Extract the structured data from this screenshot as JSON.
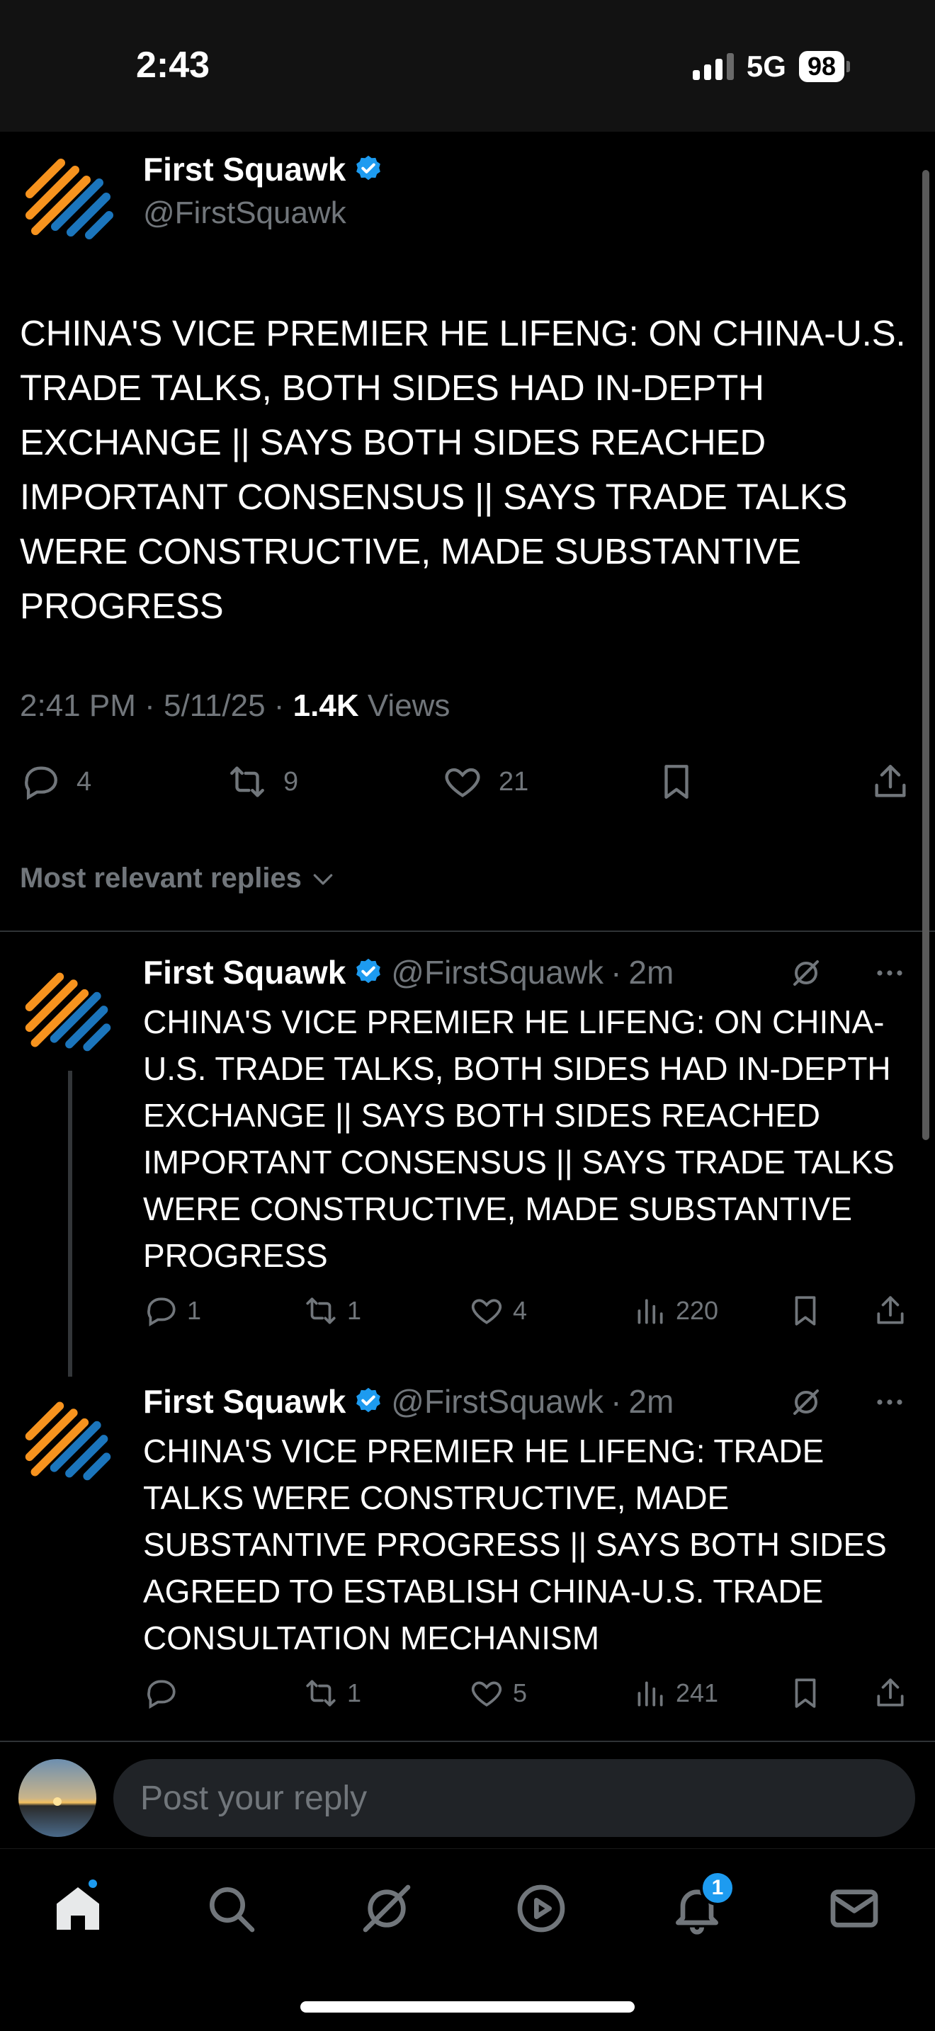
{
  "status_bar": {
    "time": "2:43",
    "network": "5G",
    "battery": "98"
  },
  "main_tweet": {
    "author_name": "First Squawk",
    "author_handle": "@FirstSquawk",
    "text": "CHINA'S VICE PREMIER HE LIFENG: ON CHINA-U.S. TRADE TALKS, BOTH SIDES HAD IN-DEPTH EXCHANGE || SAYS BOTH SIDES REACHED IMPORTANT CONSENSUS || SAYS TRADE TALKS WERE CONSTRUCTIVE, MADE SUBSTANTIVE PROGRESS",
    "time": "2:41 PM",
    "date": "5/11/25",
    "views_count": "1.4K",
    "views_label": "Views",
    "replies": "4",
    "reposts": "9",
    "likes": "21"
  },
  "replies_sort": {
    "label": "Most relevant replies"
  },
  "replies": [
    {
      "author_name": "First Squawk",
      "author_handle": "@FirstSquawk",
      "time": "2m",
      "text": "CHINA'S VICE PREMIER HE LIFENG: ON CHINA-U.S. TRADE TALKS, BOTH SIDES HAD IN-DEPTH EXCHANGE || SAYS BOTH SIDES REACHED IMPORTANT CONSENSUS || SAYS TRADE TALKS WERE CONSTRUCTIVE, MADE SUBSTANTIVE PROGRESS",
      "replies": "1",
      "reposts": "1",
      "likes": "4",
      "views": "220"
    },
    {
      "author_name": "First Squawk",
      "author_handle": "@FirstSquawk",
      "time": "2m",
      "text": "CHINA'S VICE PREMIER HE LIFENG: TRADE TALKS WERE CONSTRUCTIVE, MADE SUBSTANTIVE PROGRESS || SAYS BOTH SIDES AGREED TO ESTABLISH CHINA-U.S. TRADE CONSULTATION MECHANISM",
      "replies": "",
      "reposts": "1",
      "likes": "5",
      "views": "241"
    }
  ],
  "composer": {
    "placeholder": "Post your reply"
  },
  "tab_bar": {
    "notifications_badge": "1"
  },
  "colors": {
    "accent": "#1d9bf0",
    "logo_orange": "#f7931e",
    "logo_blue": "#1b75bc",
    "muted": "#71767b"
  }
}
